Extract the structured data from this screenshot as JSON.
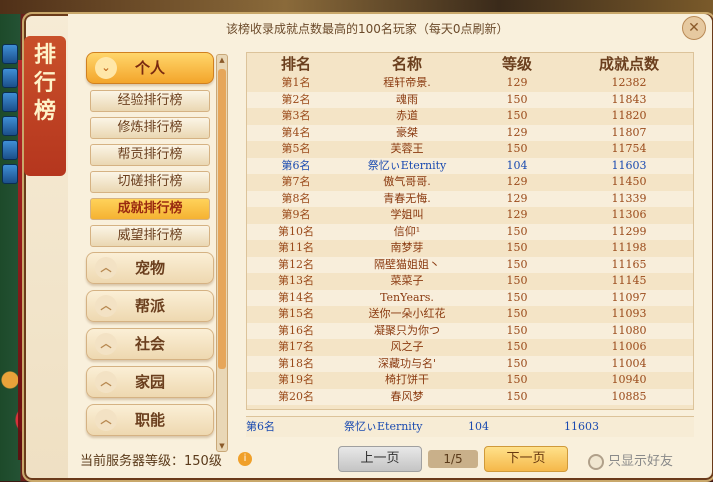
{
  "panel": {
    "side_label": [
      "排",
      "行",
      "榜"
    ],
    "banner": "该榜收录成就点数最高的100名玩家（每天0点刷新）"
  },
  "menu": {
    "categories": [
      {
        "label": "个人",
        "active": true,
        "chevron": "chevron-down-icon"
      },
      {
        "label": "宠物",
        "active": false,
        "chevron": "chevron-up-icon"
      },
      {
        "label": "帮派",
        "active": false,
        "chevron": "chevron-up-icon"
      },
      {
        "label": "社会",
        "active": false,
        "chevron": "chevron-up-icon"
      },
      {
        "label": "家园",
        "active": false,
        "chevron": "chevron-up-icon"
      },
      {
        "label": "职能",
        "active": false,
        "chevron": "chevron-up-icon"
      }
    ],
    "subitems": [
      "经验排行榜",
      "修炼排行榜",
      "帮贡排行榜",
      "切磋排行榜",
      "成就排行榜",
      "威望排行榜"
    ],
    "active_subitem": "成就排行榜"
  },
  "table": {
    "headers": [
      "排名",
      "名称",
      "等级",
      "成就点数"
    ],
    "rows": [
      {
        "rank": "第1名",
        "name": "程轩帝景.",
        "level": "129",
        "points": "12382"
      },
      {
        "rank": "第2名",
        "name": "魂雨",
        "level": "150",
        "points": "11843"
      },
      {
        "rank": "第3名",
        "name": "赤道",
        "level": "150",
        "points": "11820"
      },
      {
        "rank": "第4名",
        "name": "豪桀",
        "level": "129",
        "points": "11807"
      },
      {
        "rank": "第5名",
        "name": "芙蓉王",
        "level": "150",
        "points": "11754"
      },
      {
        "rank": "第6名",
        "name": "祭忆ぃEternity",
        "level": "104",
        "points": "11603",
        "self": true
      },
      {
        "rank": "第7名",
        "name": "傲气哥哥.",
        "level": "129",
        "points": "11450"
      },
      {
        "rank": "第8名",
        "name": "青春无悔.",
        "level": "129",
        "points": "11339"
      },
      {
        "rank": "第9名",
        "name": "学姐叫",
        "level": "129",
        "points": "11306"
      },
      {
        "rank": "第10名",
        "name": "信仰¹",
        "level": "150",
        "points": "11299"
      },
      {
        "rank": "第11名",
        "name": "南梦芽",
        "level": "150",
        "points": "11198"
      },
      {
        "rank": "第12名",
        "name": "隔壁猫姐姐丶",
        "level": "150",
        "points": "11165"
      },
      {
        "rank": "第13名",
        "name": "菜菜子",
        "level": "150",
        "points": "11145"
      },
      {
        "rank": "第14名",
        "name": "TenYears.",
        "level": "150",
        "points": "11097"
      },
      {
        "rank": "第15名",
        "name": "送你一朵小红花",
        "level": "150",
        "points": "11093"
      },
      {
        "rank": "第16名",
        "name": "凝聚只为你つ",
        "level": "150",
        "points": "11080"
      },
      {
        "rank": "第17名",
        "name": "风之子",
        "level": "150",
        "points": "11006"
      },
      {
        "rank": "第18名",
        "name": "深藏功与名'",
        "level": "150",
        "points": "11004"
      },
      {
        "rank": "第19名",
        "name": "椅打饼干",
        "level": "150",
        "points": "10940"
      },
      {
        "rank": "第20名",
        "name": "春风梦",
        "level": "150",
        "points": "10885"
      }
    ],
    "my_row": {
      "rank": "第6名",
      "name": "祭忆ぃEternity",
      "level": "104",
      "points": "11603"
    }
  },
  "footer": {
    "server_level": "当前服务器等级：150级",
    "prev_label": "上一页",
    "page": "1/5",
    "next_label": "下一页",
    "friends_only_label": "只显示好友"
  },
  "colors": {
    "self_text": "#1a4ab0",
    "row_text": "#9a4a1a",
    "active_tab": "#f3a52b"
  }
}
